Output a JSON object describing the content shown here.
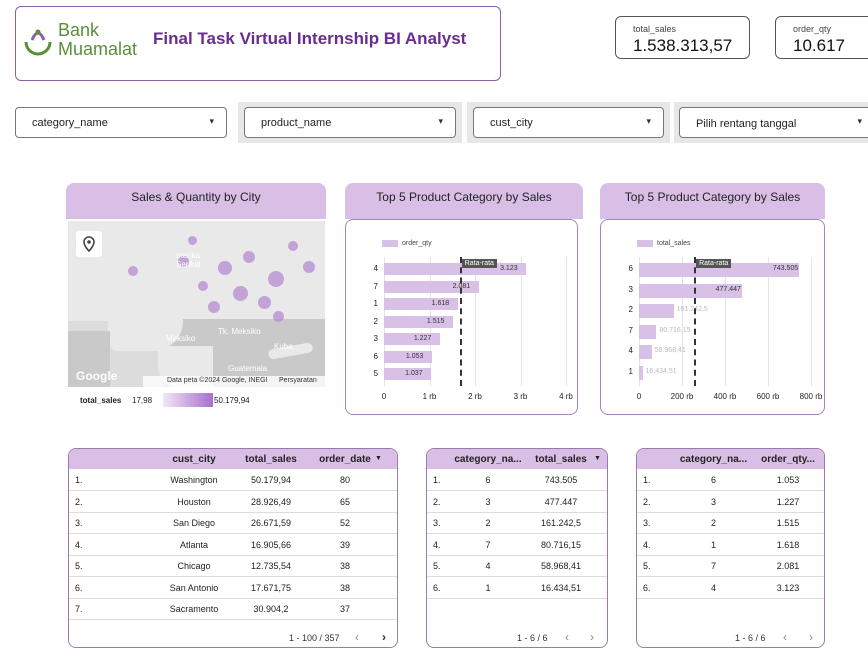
{
  "header": {
    "logo_line1": "Bank",
    "logo_line2": "Muamalat",
    "title": "Final Task Virtual Internship BI Analyst"
  },
  "kpis": [
    {
      "label": "total_sales",
      "value": "1.538.313,57"
    },
    {
      "label": "order_qty",
      "value": "10.617"
    }
  ],
  "filters": [
    {
      "label": "category_name"
    },
    {
      "label": "product_name"
    },
    {
      "label": "cust_city"
    },
    {
      "label": "Pilih rentang tanggal"
    }
  ],
  "map_panel": {
    "title": "Sales & Quantity by City",
    "labels": {
      "us": "merika\nSerikat",
      "mexico": "Meksiko",
      "gulf": "Tk. Meksiko",
      "cuba": "Kuba",
      "guatemala": "Guatemala"
    },
    "google": "Google",
    "attribution": "Data peta ©2024 Google, INEGI",
    "terms": "Persyaratan",
    "legend_metric": "total_sales",
    "legend_min": "17,98",
    "legend_max": "50.179,94"
  },
  "chart_qty": {
    "title": "Top 5 Product Category by Sales",
    "chart_data": {
      "type": "bar",
      "orientation": "horizontal",
      "legend": "order_qty",
      "categories": [
        "4",
        "7",
        "1",
        "2",
        "3",
        "6",
        "5"
      ],
      "values": [
        3123,
        2081,
        1618,
        1515,
        1227,
        1053,
        1037
      ],
      "value_labels": [
        "3.123",
        "2.081",
        "1.618",
        "1.515",
        "1.227",
        "1.053",
        "1.037"
      ],
      "average_label": "Rata-rata",
      "average": 1665,
      "xlim": [
        0,
        4000
      ],
      "xticks": [
        "0",
        "1 rb",
        "2 rb",
        "3 rb",
        "4 rb"
      ]
    }
  },
  "chart_sales": {
    "title": "Top 5 Product Category by Sales",
    "chart_data": {
      "type": "bar",
      "orientation": "horizontal",
      "legend": "total_sales",
      "categories": [
        "6",
        "3",
        "2",
        "7",
        "4",
        "1"
      ],
      "values": [
        743505,
        477447,
        161242.5,
        80716.15,
        58968.41,
        16434.51
      ],
      "value_labels": [
        "743.505",
        "477.447",
        "161.242,5",
        "80.716,15",
        "58.968,41",
        "16.434,51"
      ],
      "average_label": "Rata-rata",
      "average": 256385,
      "xlim": [
        0,
        800000
      ],
      "xticks": [
        "0",
        "200 rb",
        "400 rb",
        "600 rb",
        "800 rb"
      ]
    }
  },
  "table_city": {
    "headers": [
      "cust_city",
      "total_sales",
      "order_date"
    ],
    "sort_indicator": "▼",
    "rows": [
      [
        "1.",
        "Washington",
        "50.179,94",
        "80"
      ],
      [
        "2.",
        "Houston",
        "28.926,49",
        "65"
      ],
      [
        "3.",
        "San Diego",
        "26.671,59",
        "52"
      ],
      [
        "4.",
        "Atlanta",
        "16.905,66",
        "39"
      ],
      [
        "5.",
        "Chicago",
        "12.735,54",
        "38"
      ],
      [
        "6.",
        "San Antonio",
        "17.671,75",
        "38"
      ],
      [
        "7.",
        "Sacramento",
        "30.904,2",
        "37"
      ]
    ],
    "pager": "1 - 100 / 357"
  },
  "table_cat_sales": {
    "headers": [
      "category_na...",
      "total_sales"
    ],
    "sort_indicator": "▼",
    "rows": [
      [
        "1.",
        "6",
        "743.505"
      ],
      [
        "2.",
        "3",
        "477.447"
      ],
      [
        "3.",
        "2",
        "161.242,5"
      ],
      [
        "4.",
        "7",
        "80.716,15"
      ],
      [
        "5.",
        "4",
        "58.968,41"
      ],
      [
        "6.",
        "1",
        "16.434,51"
      ]
    ],
    "pager": "1 - 6 / 6"
  },
  "table_cat_qty": {
    "headers": [
      "category_na...",
      "order_qty..."
    ],
    "rows": [
      [
        "1.",
        "6",
        "1.053"
      ],
      [
        "2.",
        "3",
        "1.227"
      ],
      [
        "3.",
        "2",
        "1.515"
      ],
      [
        "4.",
        "1",
        "1.618"
      ],
      [
        "5.",
        "7",
        "2.081"
      ],
      [
        "6.",
        "4",
        "3.123"
      ]
    ],
    "pager": "1 - 6 / 6"
  },
  "colors": {
    "accent": "#6a2c91",
    "panel_header": "#d9bfe6",
    "bar": "#d8c0e6",
    "logo_green": "#5a8f3a"
  },
  "icons": {
    "prev": "chevron-left-icon",
    "next": "chevron-right-icon",
    "dropdown": "caret-down-icon",
    "location": "location-pin-icon"
  }
}
